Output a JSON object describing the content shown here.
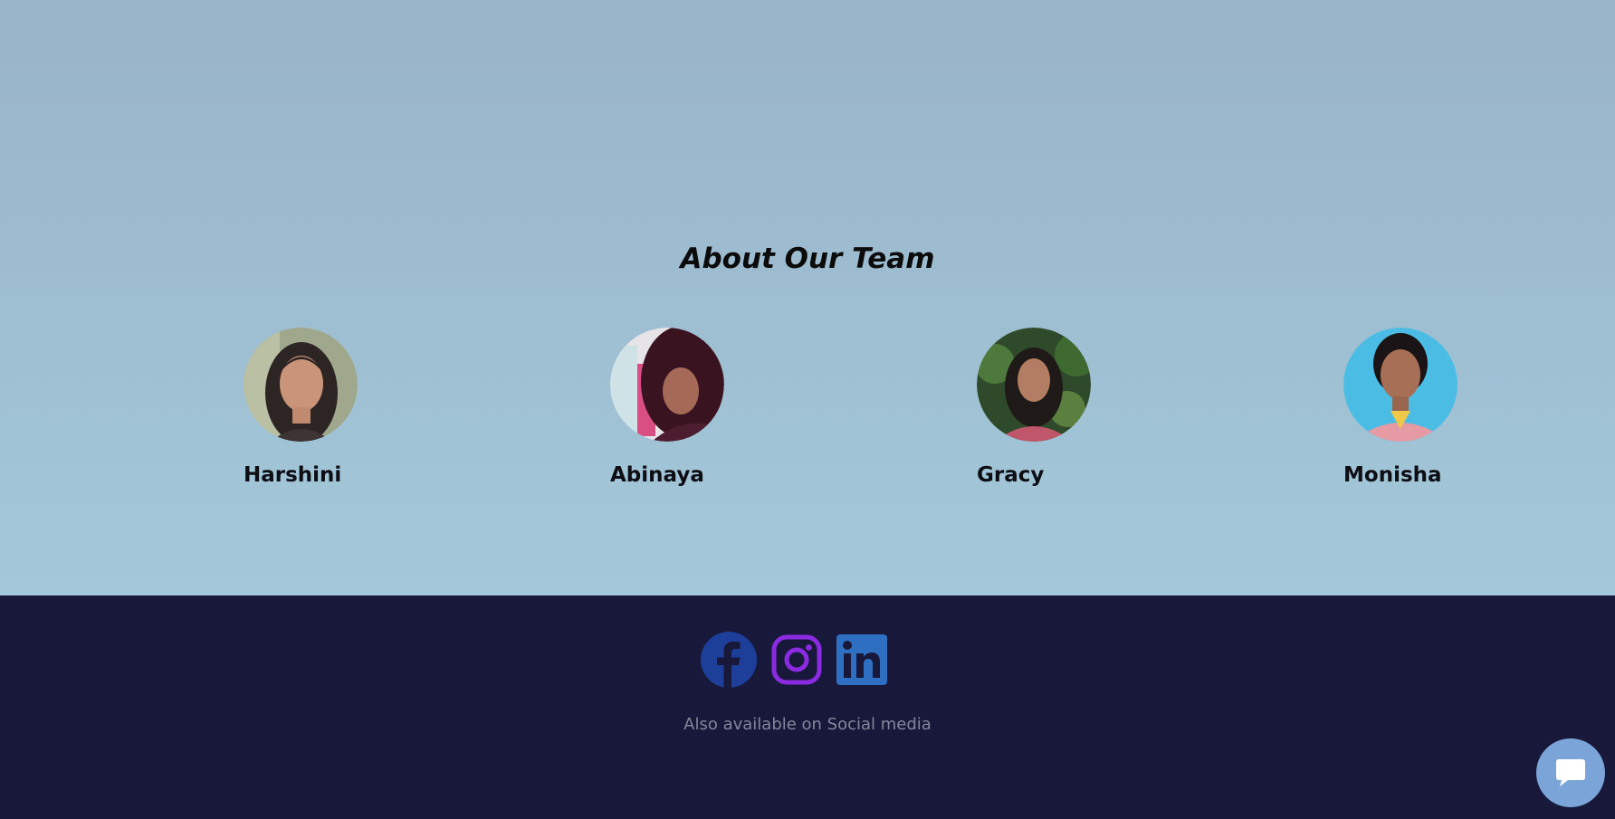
{
  "team": {
    "title": "About Our Team",
    "members": [
      {
        "name": "Harshini",
        "avatar_icon": "person-photo-harshini"
      },
      {
        "name": "Abinaya",
        "avatar_icon": "person-photo-abinaya"
      },
      {
        "name": "Gracy",
        "avatar_icon": "person-photo-gracy"
      },
      {
        "name": "Monisha",
        "avatar_icon": "person-photo-monisha"
      }
    ]
  },
  "footer": {
    "social": [
      {
        "icon": "facebook-icon",
        "color": "#1d3f99"
      },
      {
        "icon": "instagram-icon",
        "color": "#8a2be2"
      },
      {
        "icon": "linkedin-icon",
        "color": "#2f6fc2"
      }
    ],
    "tagline": "Also available on Social media"
  },
  "chat": {
    "icon": "chat-bubble-icon",
    "color": "#7ba5d8"
  },
  "colors": {
    "team_bg_top": "#99b3c8",
    "team_bg_bottom": "#a3c8da",
    "footer_bg": "#17183a"
  }
}
